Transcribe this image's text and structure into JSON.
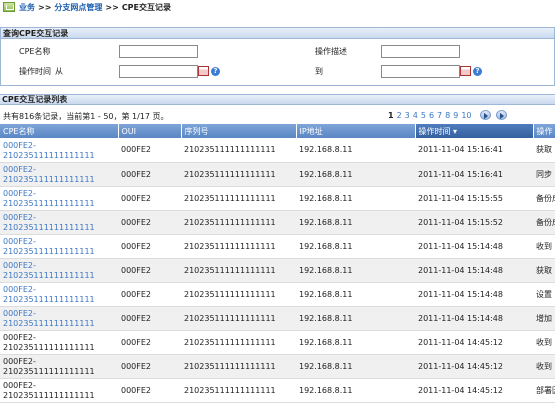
{
  "breadcrumb": {
    "level1": "业务",
    "level2": "分支网点管理",
    "current": "CPE交互记录",
    "separator": ">>"
  },
  "query": {
    "title": "查询CPE交互记录",
    "cpe_name_label": "CPE名称",
    "op_desc_label": "操作描述",
    "op_time_label": "操作时间",
    "from_label": "从",
    "to_label": "到",
    "cpe_name_value": "",
    "op_desc_value": "",
    "time_from_value": "",
    "time_to_value": ""
  },
  "list": {
    "title": "CPE交互记录列表",
    "summary": "共有816条记录，当前第1 - 50，第 1/17 页。",
    "pages": [
      "1",
      "2",
      "3",
      "4",
      "5",
      "6",
      "7",
      "8",
      "9",
      "10"
    ],
    "active_page": "1",
    "columns": {
      "cpe": "CPE名称",
      "oui": "OUI",
      "serial": "序列号",
      "ip": "IP地址",
      "time": "操作时间 ▾",
      "op": "操作"
    },
    "rows": [
      {
        "cpe": "000FE2-210235111111111111",
        "link": true,
        "oui": "000FE2",
        "serial": "210235111111111111",
        "ip": "192.168.8.11",
        "time": "2011-11-04 15:16:41",
        "op": "获取"
      },
      {
        "cpe": "000FE2-210235111111111111",
        "link": true,
        "oui": "000FE2",
        "serial": "210235111111111111",
        "ip": "192.168.8.11",
        "time": "2011-11-04 15:16:41",
        "op": "同步"
      },
      {
        "cpe": "000FE2-210235111111111111",
        "link": true,
        "oui": "000FE2",
        "serial": "210235111111111111",
        "ip": "192.168.8.11",
        "time": "2011-11-04 15:15:55",
        "op": "备份成功"
      },
      {
        "cpe": "000FE2-210235111111111111",
        "link": true,
        "oui": "000FE2",
        "serial": "210235111111111111",
        "ip": "192.168.8.11",
        "time": "2011-11-04 15:15:52",
        "op": "备份成功"
      },
      {
        "cpe": "000FE2-210235111111111111",
        "link": true,
        "oui": "000FE2",
        "serial": "210235111111111111",
        "ip": "192.168.8.11",
        "time": "2011-11-04 15:14:48",
        "op": "收到"
      },
      {
        "cpe": "000FE2-210235111111111111",
        "link": true,
        "oui": "000FE2",
        "serial": "210235111111111111",
        "ip": "192.168.8.11",
        "time": "2011-11-04 15:14:48",
        "op": "获取"
      },
      {
        "cpe": "000FE2-210235111111111111",
        "link": true,
        "oui": "000FE2",
        "serial": "210235111111111111",
        "ip": "192.168.8.11",
        "time": "2011-11-04 15:14:48",
        "op": "设置"
      },
      {
        "cpe": "000FE2-210235111111111111",
        "link": true,
        "oui": "000FE2",
        "serial": "210235111111111111",
        "ip": "192.168.8.11",
        "time": "2011-11-04 15:14:48",
        "op": "增加"
      },
      {
        "cpe": "000FE2-210235111111111111",
        "link": false,
        "oui": "000FE2",
        "serial": "210235111111111111",
        "ip": "192.168.8.11",
        "time": "2011-11-04 14:45:12",
        "op": "收到"
      },
      {
        "cpe": "000FE2-210235111111111111",
        "link": false,
        "oui": "000FE2",
        "serial": "210235111111111111",
        "ip": "192.168.8.11",
        "time": "2011-11-04 14:45:12",
        "op": "收到"
      },
      {
        "cpe": "000FE2-210235111111111111",
        "link": false,
        "oui": "000FE2",
        "serial": "210235111111111111",
        "ip": "192.168.8.11",
        "time": "2011-11-04 14:45:12",
        "op": "部署因未"
      }
    ]
  }
}
